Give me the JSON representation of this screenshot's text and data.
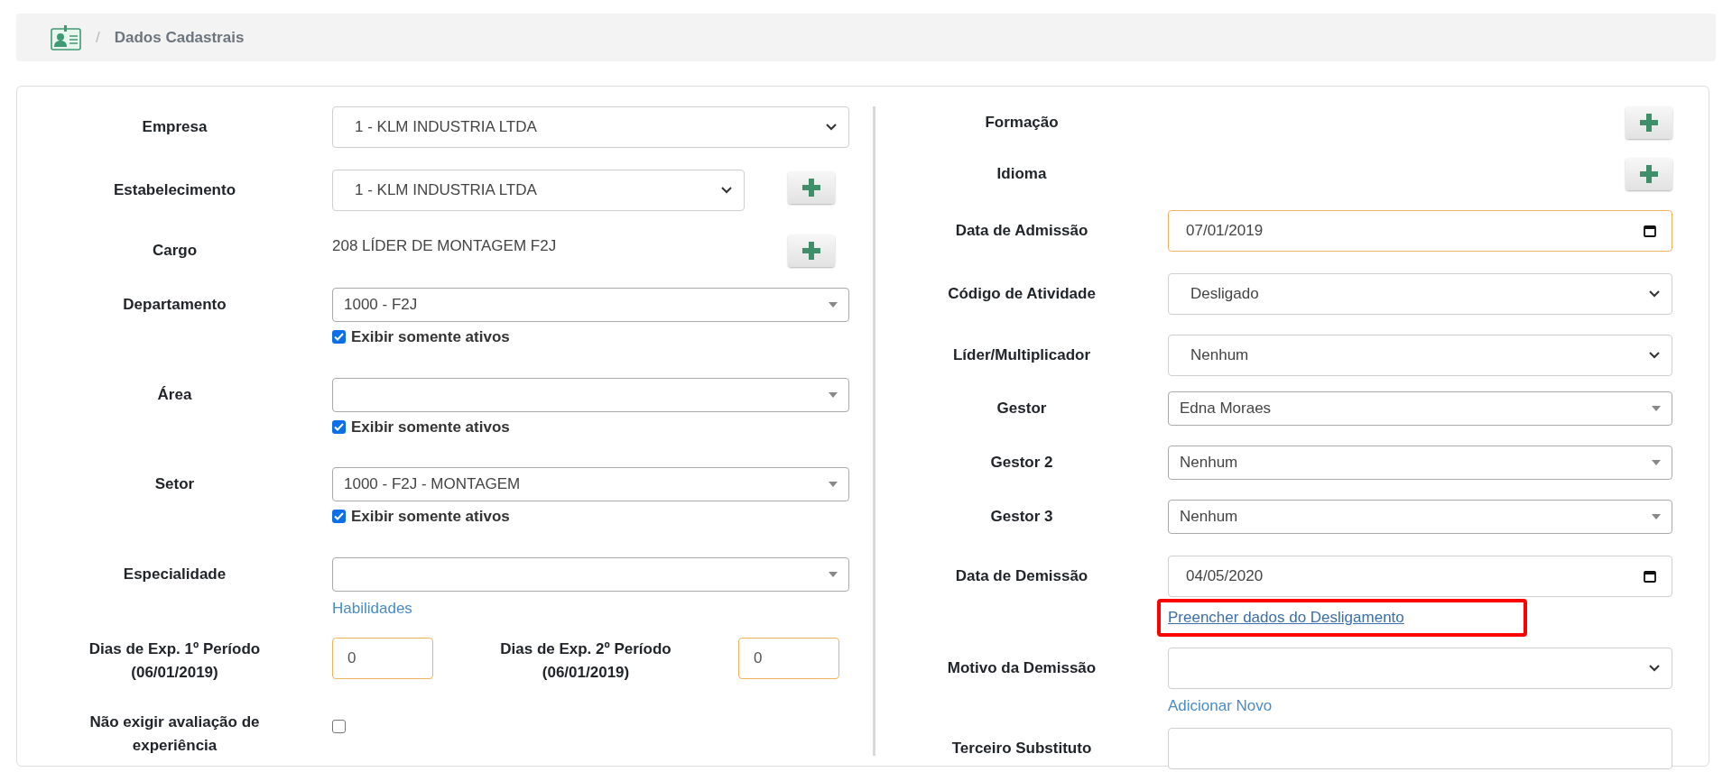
{
  "breadcrumb": {
    "separator": "/",
    "title": "Dados Cadastrais"
  },
  "left_fields": [
    {
      "kind": "select",
      "label": "Empresa",
      "value": "1 - KLM INDUSTRIA LTDA",
      "add_button": false
    },
    {
      "kind": "select",
      "label": "Estabelecimento",
      "value": "1 - KLM INDUSTRIA LTDA",
      "add_button": true
    },
    {
      "kind": "text",
      "label": "Cargo",
      "value": "208 LÍDER DE MONTAGEM F2J",
      "add_button": true
    },
    {
      "kind": "select2",
      "label": "Departamento",
      "value": "1000 - F2J",
      "active_only": {
        "label": "Exibir somente ativos",
        "checked": true
      }
    },
    {
      "kind": "select2",
      "label": "Área",
      "active_only": {
        "label": "Exibir somente ativos",
        "checked": true
      }
    },
    {
      "kind": "select2",
      "label": "Setor",
      "value": "1000 - F2J - MONTAGEM",
      "active_only": {
        "label": "Exibir somente ativos",
        "checked": true
      }
    },
    {
      "kind": "select2",
      "label": "Especialidade",
      "link": {
        "text": "Habilidades",
        "highlighted": false
      }
    },
    {
      "kind": "pair",
      "items": [
        {
          "label": "Dias de Exp. 1º Período (06/01/2019)",
          "value": "0"
        },
        {
          "label": "Dias de Exp. 2º Período (06/01/2019)",
          "value": "0"
        }
      ]
    },
    {
      "kind": "checkbox",
      "label": "Não exigir avaliação de experiência",
      "checked": false
    }
  ],
  "right_fields": [
    {
      "kind": "none",
      "label": "Formação",
      "add_button": true
    },
    {
      "kind": "none",
      "label": "Idioma",
      "add_button": true
    },
    {
      "kind": "date",
      "label": "Data de Admissão",
      "value": "07/01/2019",
      "focused": true
    },
    {
      "kind": "select",
      "label": "Código de Atividade",
      "value": "Desligado"
    },
    {
      "kind": "select",
      "label": "Líder/Multiplicador",
      "value": "Nenhum"
    },
    {
      "kind": "select2",
      "label": "Gestor",
      "value": "Edna Moraes"
    },
    {
      "kind": "select2",
      "label": "Gestor 2",
      "value": "Nenhum"
    },
    {
      "kind": "select2",
      "label": "Gestor 3",
      "value": "Nenhum"
    },
    {
      "kind": "date",
      "label": "Data de Demissão",
      "value": "04/05/2020",
      "focused": false,
      "link": {
        "text": "Preencher dados do Desligamento",
        "highlighted": true
      }
    },
    {
      "kind": "select",
      "label": "Motivo da Demissão",
      "link": {
        "text": "Adicionar Novo",
        "highlighted": false
      }
    },
    {
      "kind": "input",
      "label": "Terceiro Substituto"
    }
  ]
}
